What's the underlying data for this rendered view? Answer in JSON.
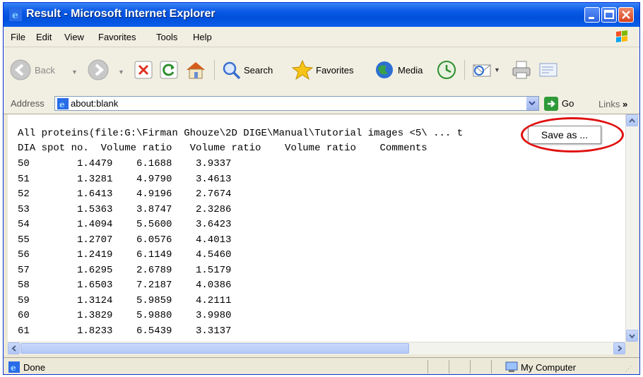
{
  "window": {
    "title": "Result - Microsoft Internet Explorer"
  },
  "menu": {
    "items": [
      "File",
      "Edit",
      "View",
      "Favorites",
      "Tools",
      "Help"
    ]
  },
  "toolbar": {
    "back_label": "Back",
    "search_label": "Search",
    "favorites_label": "Favorites",
    "media_label": "Media"
  },
  "address": {
    "label": "Address",
    "value": "about:blank",
    "go_label": "Go",
    "links_label": "Links"
  },
  "content": {
    "header_line": "All proteins(file:G:\\Firman Ghouze\\2D DIGE\\Manual\\Tutorial images <5\\ ... t",
    "column_line": "DIA spot no.  Volume ratio   Volume ratio    Volume ratio    Comments",
    "rows": [
      [
        "50",
        "1.4479",
        "6.1688",
        "3.9337"
      ],
      [
        "51",
        "1.3281",
        "4.9790",
        "3.4613"
      ],
      [
        "52",
        "1.6413",
        "4.9196",
        "2.7674"
      ],
      [
        "53",
        "1.5363",
        "3.8747",
        "2.3286"
      ],
      [
        "54",
        "1.4094",
        "5.5600",
        "3.6423"
      ],
      [
        "55",
        "1.2707",
        "6.0576",
        "4.4013"
      ],
      [
        "56",
        "1.2419",
        "6.1149",
        "4.5460"
      ],
      [
        "57",
        "1.6295",
        "2.6789",
        "1.5179"
      ],
      [
        "58",
        "1.6503",
        "7.2187",
        "4.0386"
      ],
      [
        "59",
        "1.3124",
        "5.9859",
        "4.2111"
      ],
      [
        "60",
        "1.3829",
        "5.9880",
        "3.9980"
      ],
      [
        "61",
        "1.8233",
        "6.5439",
        "3.3137"
      ]
    ]
  },
  "popup": {
    "save_as_label": "Save as ..."
  },
  "status": {
    "left_text": "Done",
    "zone_text": "My Computer"
  },
  "colors": {
    "titlebar": "#0a5ae6",
    "highlight_ring": "#e01010"
  }
}
